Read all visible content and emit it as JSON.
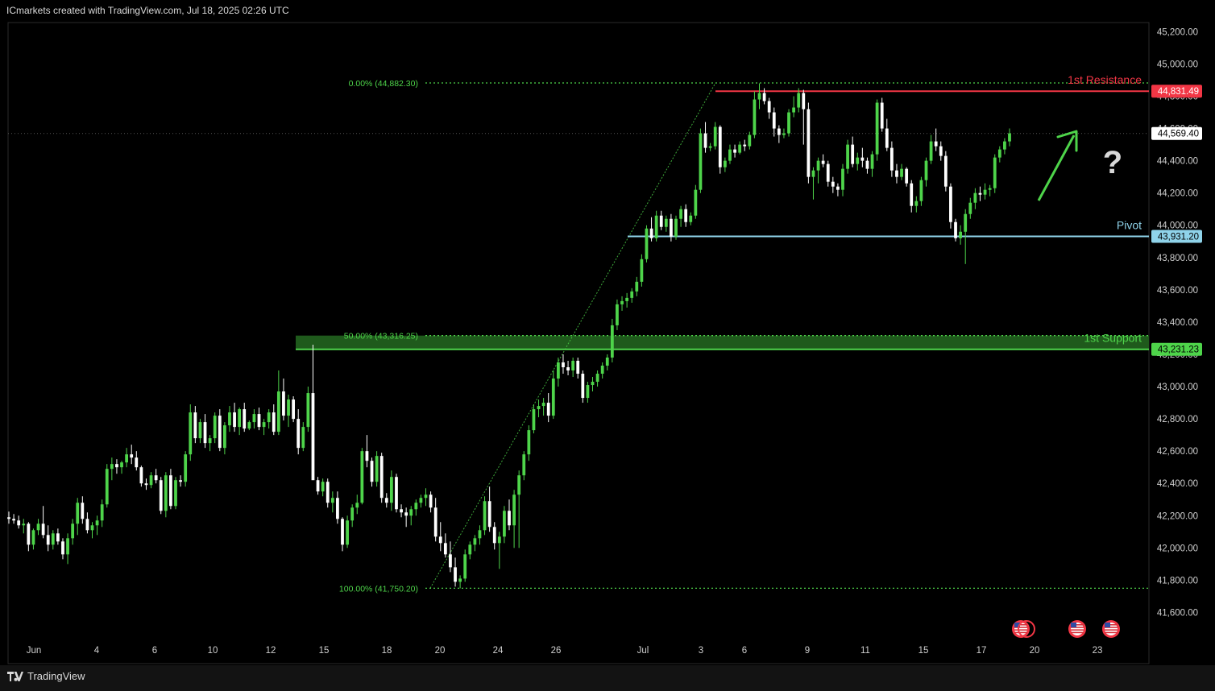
{
  "header": {
    "attribution": "ICmarkets created with TradingView.com, Jul 18, 2025 02:26 UTC"
  },
  "footer": {
    "logo_text": "TradingView"
  },
  "colors": {
    "background": "#000000",
    "up_candle": "#4ed44a",
    "down_candle": "#ffffff",
    "resistance": "#f23645",
    "pivot": "#8fd3ea",
    "support": "#4ed44a",
    "fib": "#4ed44a",
    "arrow": "#4ed44a"
  },
  "chart_data": {
    "type": "candlestick",
    "title": "",
    "ylim": [
      41550,
      45300
    ],
    "price_ticks": [
      41600,
      41800,
      42000,
      42200,
      42400,
      42600,
      42800,
      43000,
      43200,
      43400,
      43600,
      43800,
      44000,
      44200,
      44400,
      44600,
      44800,
      45000,
      45200
    ],
    "price_tick_labels": [
      "41,600.00",
      "41,800.00",
      "42,000.00",
      "42,200.00",
      "42,400.00",
      "42,600.00",
      "42,800.00",
      "43,000.00",
      "43,200.00",
      "43,400.00",
      "43,600.00",
      "43,800.00",
      "44,000.00",
      "44,200.00",
      "44,400.00",
      "44,600.00",
      "44,800.00",
      "45,000.00",
      "45,200.00"
    ],
    "time_labels": [
      "Jun",
      "4",
      "6",
      "10",
      "12",
      "15",
      "18",
      "20",
      "24",
      "26",
      "Jul",
      "3",
      "6",
      "9",
      "11",
      "15",
      "17",
      "20",
      "23"
    ],
    "current_price": {
      "value": 44569.4,
      "label": "44,569.40"
    },
    "levels": [
      {
        "name": "1st Resistance",
        "value": 44831.49,
        "label": "44,831.49",
        "color": "#f23645"
      },
      {
        "name": "Pivot",
        "value": 43931.2,
        "label": "43,931.20",
        "color": "#8fd3ea"
      },
      {
        "name": "1st Support",
        "value": 43231.23,
        "label": "43,231.23",
        "color": "#4ed44a"
      }
    ],
    "fib_levels": [
      {
        "label": "0.00% (44,882.30)",
        "value": 44882.3
      },
      {
        "label": "50.00% (43,316.25)",
        "value": 43316.25
      },
      {
        "label": "100.00% (41,750.20)",
        "value": 41750.2
      }
    ],
    "annotations": {
      "question_mark": "?"
    },
    "event_icon_count": 3,
    "ohlc": [
      [
        42190,
        42225,
        42150,
        42180
      ],
      [
        42180,
        42210,
        42150,
        42170
      ],
      [
        42170,
        42200,
        42120,
        42140
      ],
      [
        42140,
        42180,
        42090,
        42150
      ],
      [
        42150,
        42160,
        41980,
        42020
      ],
      [
        42020,
        42120,
        41990,
        42110
      ],
      [
        42110,
        42180,
        42080,
        42150
      ],
      [
        42150,
        42260,
        42060,
        42080
      ],
      [
        42080,
        42140,
        41980,
        42020
      ],
      [
        42020,
        42110,
        41990,
        42090
      ],
      [
        42090,
        42120,
        42020,
        42040
      ],
      [
        42040,
        42060,
        41930,
        41960
      ],
      [
        41960,
        42090,
        41900,
        42060
      ],
      [
        42060,
        42180,
        42020,
        42150
      ],
      [
        42150,
        42310,
        42080,
        42280
      ],
      [
        42280,
        42320,
        42150,
        42180
      ],
      [
        42180,
        42220,
        42090,
        42110
      ],
      [
        42110,
        42160,
        42060,
        42140
      ],
      [
        42140,
        42200,
        42080,
        42170
      ],
      [
        42170,
        42300,
        42130,
        42270
      ],
      [
        42270,
        42520,
        42250,
        42490
      ],
      [
        42490,
        42560,
        42420,
        42520
      ],
      [
        42520,
        42550,
        42460,
        42500
      ],
      [
        42500,
        42540,
        42460,
        42530
      ],
      [
        42530,
        42620,
        42500,
        42580
      ],
      [
        42580,
        42640,
        42520,
        42560
      ],
      [
        42560,
        42600,
        42480,
        42500
      ],
      [
        42500,
        42510,
        42380,
        42400
      ],
      [
        42400,
        42430,
        42360,
        42390
      ],
      [
        42390,
        42470,
        42370,
        42450
      ],
      [
        42450,
        42490,
        42400,
        42420
      ],
      [
        42420,
        42440,
        42210,
        42230
      ],
      [
        42230,
        42470,
        42190,
        42450
      ],
      [
        42450,
        42490,
        42240,
        42260
      ],
      [
        42260,
        42440,
        42240,
        42420
      ],
      [
        42420,
        42450,
        42380,
        42410
      ],
      [
        42410,
        42600,
        42380,
        42580
      ],
      [
        42580,
        42890,
        42540,
        42840
      ],
      [
        42840,
        42880,
        42650,
        42680
      ],
      [
        42680,
        42800,
        42650,
        42780
      ],
      [
        42780,
        42830,
        42620,
        42650
      ],
      [
        42650,
        42700,
        42600,
        42680
      ],
      [
        42680,
        42840,
        42650,
        42820
      ],
      [
        42820,
        42860,
        42600,
        42620
      ],
      [
        42620,
        42780,
        42580,
        42760
      ],
      [
        42760,
        42880,
        42720,
        42840
      ],
      [
        42840,
        42900,
        42720,
        42750
      ],
      [
        42750,
        42870,
        42700,
        42860
      ],
      [
        42860,
        42900,
        42720,
        42740
      ],
      [
        42740,
        42790,
        42730,
        42780
      ],
      [
        42780,
        42860,
        42740,
        42830
      ],
      [
        42830,
        42870,
        42730,
        42750
      ],
      [
        42750,
        42800,
        42700,
        42780
      ],
      [
        42780,
        42860,
        42740,
        42840
      ],
      [
        42840,
        42890,
        42700,
        42720
      ],
      [
        42720,
        43100,
        42700,
        42970
      ],
      [
        42970,
        43050,
        42790,
        42820
      ],
      [
        42820,
        42950,
        42750,
        42920
      ],
      [
        42920,
        42940,
        42780,
        42800
      ],
      [
        42800,
        42860,
        42580,
        42620
      ],
      [
        42620,
        42780,
        42600,
        42750
      ],
      [
        42750,
        43000,
        42720,
        42960
      ],
      [
        42960,
        43260,
        42620,
        42420
      ],
      [
        42420,
        42440,
        42330,
        42350
      ],
      [
        42350,
        42430,
        42320,
        42410
      ],
      [
        42410,
        42430,
        42250,
        42280
      ],
      [
        42280,
        42350,
        42220,
        42310
      ],
      [
        42310,
        42350,
        42150,
        42180
      ],
      [
        42180,
        42190,
        41980,
        42020
      ],
      [
        42020,
        42200,
        42000,
        42170
      ],
      [
        42170,
        42270,
        42130,
        42250
      ],
      [
        42250,
        42330,
        42210,
        42280
      ],
      [
        42280,
        42620,
        42270,
        42600
      ],
      [
        42600,
        42700,
        42500,
        42540
      ],
      [
        42540,
        42560,
        42380,
        42410
      ],
      [
        42410,
        42600,
        42380,
        42570
      ],
      [
        42570,
        42590,
        42280,
        42310
      ],
      [
        42310,
        42340,
        42250,
        42280
      ],
      [
        42280,
        42480,
        42230,
        42440
      ],
      [
        42440,
        42460,
        42220,
        42240
      ],
      [
        42240,
        42270,
        42190,
        42220
      ],
      [
        42220,
        42250,
        42130,
        42200
      ],
      [
        42200,
        42260,
        42140,
        42240
      ],
      [
        42240,
        42300,
        42200,
        42280
      ],
      [
        42280,
        42330,
        42250,
        42310
      ],
      [
        42310,
        42370,
        42260,
        42330
      ],
      [
        42330,
        42350,
        42220,
        42250
      ],
      [
        42250,
        42310,
        42040,
        42070
      ],
      [
        42070,
        42160,
        41980,
        42030
      ],
      [
        42030,
        42090,
        41940,
        41960
      ],
      [
        41960,
        42040,
        41850,
        41880
      ],
      [
        41880,
        41940,
        41760,
        41790
      ],
      [
        41790,
        41830,
        41750,
        41810
      ],
      [
        41810,
        41990,
        41790,
        41960
      ],
      [
        41960,
        42040,
        41930,
        42020
      ],
      [
        42020,
        42080,
        41980,
        42060
      ],
      [
        42060,
        42140,
        42020,
        42110
      ],
      [
        42110,
        42320,
        42080,
        42290
      ],
      [
        42290,
        42380,
        42100,
        42130
      ],
      [
        42130,
        42160,
        41990,
        42030
      ],
      [
        42030,
        42100,
        41870,
        42070
      ],
      [
        42070,
        42260,
        42030,
        42230
      ],
      [
        42230,
        42300,
        42110,
        42140
      ],
      [
        42140,
        42360,
        42000,
        42330
      ],
      [
        42330,
        42480,
        42000,
        42450
      ],
      [
        42450,
        42600,
        42420,
        42580
      ],
      [
        42580,
        42760,
        42540,
        42730
      ],
      [
        42730,
        42890,
        42710,
        42860
      ],
      [
        42860,
        42920,
        42810,
        42880
      ],
      [
        42880,
        42930,
        42820,
        42900
      ],
      [
        42900,
        42960,
        42780,
        42820
      ],
      [
        42820,
        43100,
        42800,
        43050
      ],
      [
        43050,
        43180,
        43000,
        43150
      ],
      [
        43150,
        43200,
        43080,
        43120
      ],
      [
        43120,
        43160,
        43070,
        43100
      ],
      [
        43100,
        43180,
        43060,
        43160
      ],
      [
        43160,
        43180,
        43050,
        43080
      ],
      [
        43080,
        43100,
        42900,
        42930
      ],
      [
        42930,
        43030,
        42900,
        43010
      ],
      [
        43010,
        43060,
        42970,
        43030
      ],
      [
        43030,
        43100,
        43000,
        43080
      ],
      [
        43080,
        43150,
        43050,
        43130
      ],
      [
        43130,
        43200,
        43100,
        43180
      ],
      [
        43180,
        43420,
        43150,
        43380
      ],
      [
        43380,
        43540,
        43350,
        43510
      ],
      [
        43510,
        43560,
        43470,
        43530
      ],
      [
        43530,
        43580,
        43490,
        43550
      ],
      [
        43550,
        43610,
        43520,
        43590
      ],
      [
        43590,
        43680,
        43560,
        43650
      ],
      [
        43650,
        43820,
        43620,
        43790
      ],
      [
        43790,
        44000,
        43770,
        43980
      ],
      [
        43980,
        44050,
        43900,
        43920
      ],
      [
        43920,
        44090,
        43900,
        44060
      ],
      [
        44060,
        44090,
        43970,
        43990
      ],
      [
        43990,
        44060,
        43960,
        44040
      ],
      [
        44040,
        44070,
        43900,
        43930
      ],
      [
        43930,
        44060,
        43910,
        44040
      ],
      [
        44040,
        44120,
        43990,
        44100
      ],
      [
        44100,
        44130,
        43990,
        44020
      ],
      [
        44020,
        44080,
        44000,
        44060
      ],
      [
        44060,
        44250,
        44040,
        44220
      ],
      [
        44220,
        44600,
        44200,
        44570
      ],
      [
        44570,
        44640,
        44450,
        44480
      ],
      [
        44480,
        44510,
        44460,
        44490
      ],
      [
        44490,
        44640,
        44470,
        44610
      ],
      [
        44610,
        44620,
        44320,
        44360
      ],
      [
        44360,
        44420,
        44330,
        44400
      ],
      [
        44400,
        44500,
        44380,
        44470
      ],
      [
        44470,
        44500,
        44420,
        44450
      ],
      [
        44450,
        44520,
        44440,
        44500
      ],
      [
        44500,
        44530,
        44460,
        44490
      ],
      [
        44490,
        44580,
        44470,
        44560
      ],
      [
        44560,
        44830,
        44540,
        44780
      ],
      [
        44780,
        44880,
        44720,
        44820
      ],
      [
        44820,
        44850,
        44750,
        44770
      ],
      [
        44770,
        44790,
        44660,
        44700
      ],
      [
        44700,
        44730,
        44550,
        44600
      ],
      [
        44600,
        44620,
        44510,
        44560
      ],
      [
        44560,
        44600,
        44540,
        44570
      ],
      [
        44570,
        44720,
        44550,
        44700
      ],
      [
        44700,
        44800,
        44670,
        44730
      ],
      [
        44730,
        44850,
        44700,
        44820
      ],
      [
        44820,
        44840,
        44500,
        44720
      ],
      [
        44720,
        44760,
        44260,
        44300
      ],
      [
        44300,
        44360,
        44160,
        44340
      ],
      [
        44340,
        44420,
        44260,
        44400
      ],
      [
        44400,
        44440,
        44360,
        44380
      ],
      [
        44380,
        44400,
        44240,
        44270
      ],
      [
        44270,
        44300,
        44200,
        44240
      ],
      [
        44240,
        44260,
        44180,
        44220
      ],
      [
        44220,
        44380,
        44180,
        44350
      ],
      [
        44350,
        44530,
        44320,
        44500
      ],
      [
        44500,
        44550,
        44360,
        44380
      ],
      [
        44380,
        44450,
        44340,
        44420
      ],
      [
        44420,
        44480,
        44360,
        44400
      ],
      [
        44400,
        44420,
        44320,
        44350
      ],
      [
        44350,
        44460,
        44300,
        44440
      ],
      [
        44440,
        44780,
        44400,
        44760
      ],
      [
        44760,
        44790,
        44580,
        44600
      ],
      [
        44600,
        44660,
        44460,
        44480
      ],
      [
        44480,
        44520,
        44300,
        44340
      ],
      [
        44340,
        44380,
        44260,
        44300
      ],
      [
        44300,
        44380,
        44280,
        44350
      ],
      [
        44350,
        44360,
        44240,
        44260
      ],
      [
        44260,
        44280,
        44080,
        44120
      ],
      [
        44120,
        44180,
        44080,
        44150
      ],
      [
        44150,
        44300,
        44120,
        44280
      ],
      [
        44280,
        44420,
        44240,
        44400
      ],
      [
        44400,
        44560,
        44380,
        44520
      ],
      [
        44520,
        44600,
        44460,
        44490
      ],
      [
        44490,
        44520,
        44400,
        44430
      ],
      [
        44430,
        44460,
        44210,
        44240
      ],
      [
        44240,
        44260,
        43980,
        44020
      ],
      [
        44020,
        44040,
        43900,
        43920
      ],
      [
        43920,
        44000,
        43880,
        43960
      ],
      [
        43960,
        44100,
        43760,
        44070
      ],
      [
        44070,
        44170,
        44040,
        44140
      ],
      [
        44140,
        44230,
        44100,
        44200
      ],
      [
        44200,
        44240,
        44150,
        44190
      ],
      [
        44190,
        44260,
        44160,
        44220
      ],
      [
        44220,
        44250,
        44180,
        44230
      ],
      [
        44230,
        44440,
        44200,
        44420
      ],
      [
        44420,
        44490,
        44390,
        44470
      ],
      [
        44470,
        44540,
        44440,
        44520
      ],
      [
        44520,
        44600,
        44490,
        44570
      ]
    ]
  }
}
